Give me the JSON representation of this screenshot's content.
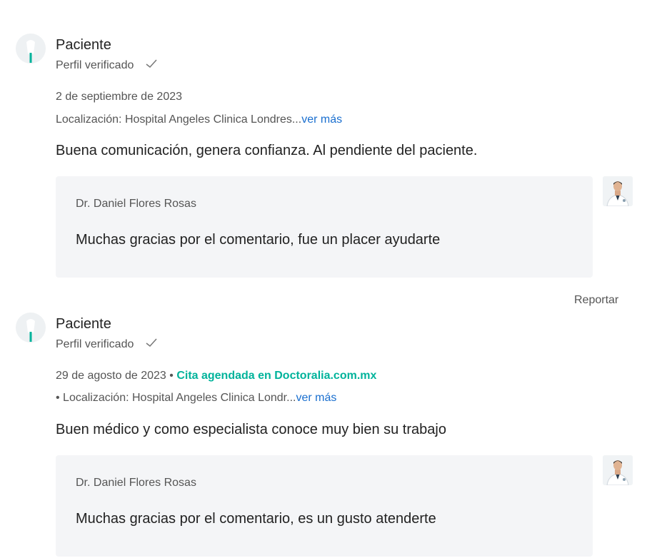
{
  "reviews": [
    {
      "author": "Paciente",
      "verified": "Perfil verificado",
      "date": "2 de septiembre de 2023",
      "booking": "",
      "location": "Localización: Hospital Angeles Clinica Londres...",
      "more": "ver más",
      "text": "Buena comunicación, genera confianza. Al pendiente del paciente.",
      "reply": {
        "doctor": "Dr. Daniel Flores Rosas",
        "text": "Muchas gracias por el comentario, fue un placer ayudarte"
      },
      "report": "Reportar"
    },
    {
      "author": "Paciente",
      "verified": "Perfil verificado",
      "date": "29 de agosto de 2023 •",
      "booking": "Cita agendada en Doctoralia.com.mx",
      "location": "• Localización: Hospital Angeles Clinica Londr...",
      "more": "ver más",
      "text": "Buen médico y como especialista conoce muy bien su trabajo",
      "reply": {
        "doctor": "Dr. Daniel Flores Rosas",
        "text": "Muchas gracias por el comentario, es un gusto atenderte"
      }
    }
  ],
  "colors": {
    "link": "#1a6fcf",
    "booking": "#00b39b",
    "reply_bg": "#f4f5f7"
  }
}
